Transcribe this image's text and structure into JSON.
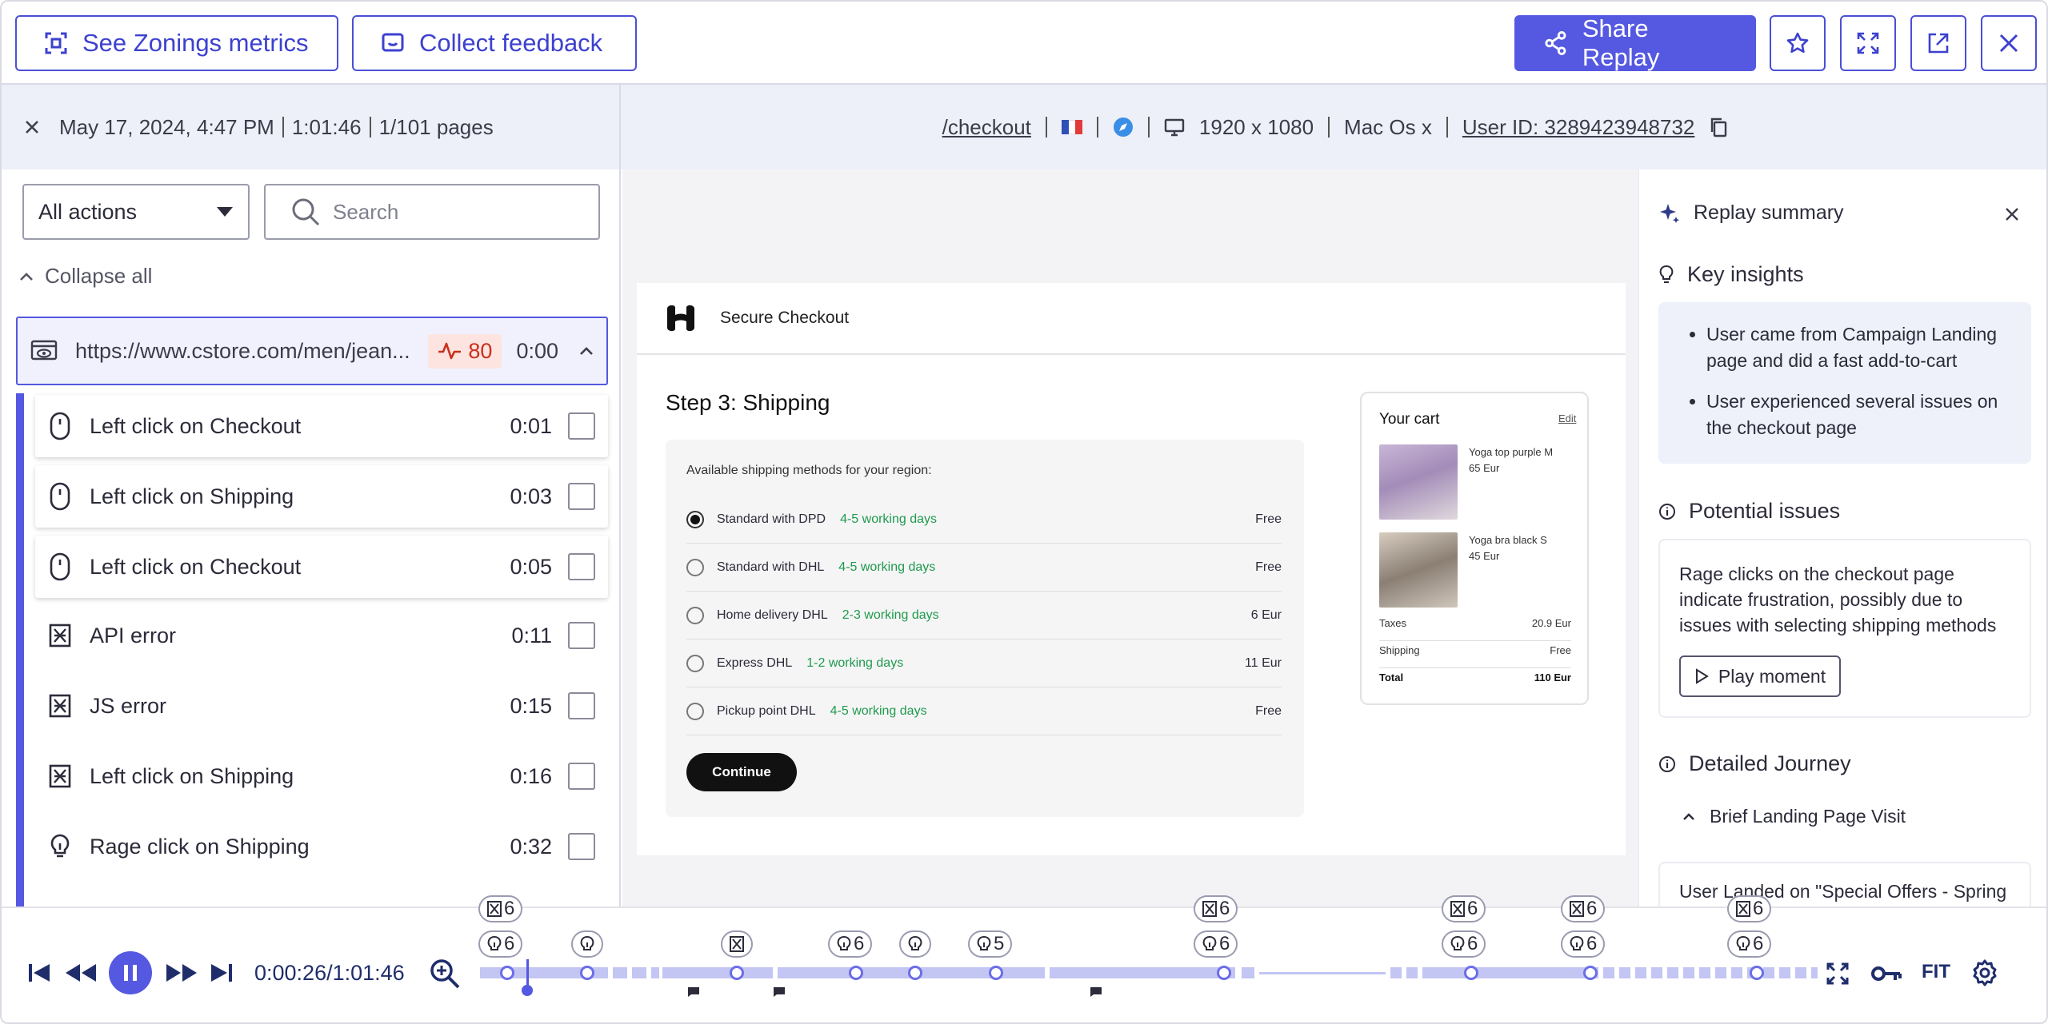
{
  "toolbar": {
    "zonings_label": "See Zonings metrics",
    "feedback_label": "Collect feedback",
    "share_label": "Share Replay"
  },
  "session": {
    "date": "May 17, 2024, 4:47 PM",
    "duration": "1:01:46",
    "pages": "1/101 pages",
    "path": "/checkout",
    "resolution": "1920 x 1080",
    "os": "Mac Os x",
    "user_id": "User ID: 3289423948732"
  },
  "left": {
    "filter_value": "All actions",
    "search_placeholder": "Search",
    "collapse_label": "Collapse all",
    "url": "https://www.cstore.com/men/jean...",
    "frustration_score": "80",
    "url_time": "0:00",
    "items": [
      {
        "label": "Left click on Checkout",
        "time": "0:01",
        "icon": "mouse-icon"
      },
      {
        "label": "Left click on Shipping",
        "time": "0:03",
        "icon": "mouse-icon"
      },
      {
        "label": "Left click on Checkout",
        "time": "0:05",
        "icon": "mouse-icon"
      },
      {
        "label": "API error",
        "time": "0:11",
        "icon": "error-icon"
      },
      {
        "label": "JS error",
        "time": "0:15",
        "icon": "error-icon"
      },
      {
        "label": "Left click on Shipping",
        "time": "0:16",
        "icon": "error-icon"
      },
      {
        "label": "Rage click on Shipping",
        "time": "0:32",
        "icon": "bulb-icon"
      }
    ]
  },
  "checkout": {
    "brand": "Secure Checkout",
    "step_title": "Step 3: Shipping",
    "methods_label": "Available shipping methods for your region:",
    "methods": [
      {
        "name": "Standard with DPD",
        "days": "4-5 working days",
        "price": "Free"
      },
      {
        "name": "Standard with DHL",
        "days": "4-5 working days",
        "price": "Free"
      },
      {
        "name": "Home delivery DHL",
        "days": "2-3 working days",
        "price": "6 Eur"
      },
      {
        "name": "Express DHL",
        "days": "1-2 working days",
        "price": "11 Eur"
      },
      {
        "name": "Pickup point DHL",
        "days": "4-5 working days",
        "price": "Free"
      }
    ],
    "continue_label": "Continue",
    "cart": {
      "title": "Your cart",
      "edit": "Edit",
      "items": [
        {
          "name": "Yoga top purple M",
          "price": "65 Eur"
        },
        {
          "name": "Yoga bra black S",
          "price": "45 Eur"
        }
      ],
      "taxes_label": "Taxes",
      "taxes": "20.9 Eur",
      "shipping_label": "Shipping",
      "shipping": "Free",
      "total_label": "Total",
      "total": "110 Eur"
    }
  },
  "summary": {
    "title": "Replay summary",
    "key_insights_title": "Key insights",
    "insights": [
      "User came from Campaign Landing page and did a fast add-to-cart",
      "User experienced several issues on the checkout page"
    ],
    "issues_title": "Potential issues",
    "issue_text": "Rage clicks on the checkout page indicate frustration, possibly due to issues with selecting shipping methods",
    "play_label": "Play moment",
    "journey_title": "Detailed Journey",
    "journey_section": "Brief Landing Page Visit",
    "journey_text": "User Landed on \"Special Offers - Spring"
  },
  "timeline": {
    "time": "0:00:26/1:01:46",
    "fit_label": "FIT",
    "markers_top": [
      "6",
      "6",
      "6",
      "6",
      "6"
    ],
    "markers_bottom": [
      "6",
      "",
      "",
      "6",
      "",
      "5",
      "6",
      "6",
      "6",
      "6"
    ],
    "progress_fraction": 0.007
  },
  "colors": {
    "accent": "#5558e0",
    "frustration": "#c9301c",
    "working_days": "#1f9a4c"
  }
}
